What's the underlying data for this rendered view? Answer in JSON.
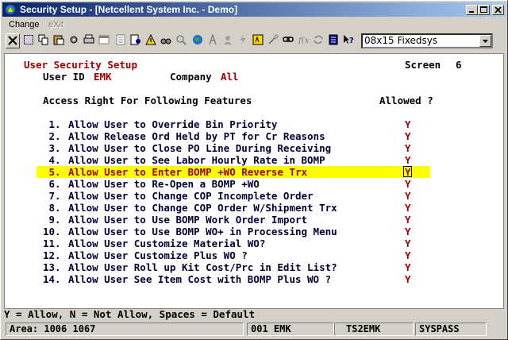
{
  "window": {
    "title": "Security Setup - [Netcellent System Inc. - Demo]"
  },
  "menu": {
    "change": "Change",
    "exit": "eXit"
  },
  "toolbar": {
    "font_select": "08x15 Fixedsys"
  },
  "screen": {
    "heading": "User Security Setup",
    "screen_label": "Screen",
    "screen_number": "6",
    "user_id_label": "User ID",
    "user_id": "EMK",
    "company_label": "Company",
    "company": "All",
    "section_title": "Access Right For Following Features",
    "allowed_header": "Allowed ?",
    "rows": [
      {
        "num": " 1.",
        "text": "Allow User to Override Bin Priority",
        "value": "Y"
      },
      {
        "num": " 2.",
        "text": "Allow Release Ord Held by PT for Cr Reasons",
        "value": "Y"
      },
      {
        "num": " 3.",
        "text": "Allow User to Close PO Line During Receiving",
        "value": "Y"
      },
      {
        "num": " 4.",
        "text": "Allow User to See Labor Hourly Rate in BOMP",
        "value": "Y"
      },
      {
        "num": " 5.",
        "text": "Allow User to Enter BOMP +WO Reverse Trx",
        "value": "Y"
      },
      {
        "num": " 6.",
        "text": "Allow User to Re-Open a BOMP +WO",
        "value": "Y"
      },
      {
        "num": " 7.",
        "text": "Allow User to Change COP Incomplete Order",
        "value": "Y"
      },
      {
        "num": " 8.",
        "text": "Allow User to Change COP Order W/Shipment Trx",
        "value": "Y"
      },
      {
        "num": " 9.",
        "text": "Allow User to Use BOMP Work Order Import",
        "value": "Y"
      },
      {
        "num": "10.",
        "text": "Allow User to Use BOMP WO+ in Processing Menu",
        "value": "Y"
      },
      {
        "num": "11.",
        "text": "Allow User Customize Material WO?",
        "value": "Y"
      },
      {
        "num": "12.",
        "text": "Allow User Customize Plus WO ?",
        "value": "Y"
      },
      {
        "num": "13.",
        "text": "Allow User Roll up Kit Cost/Prc in Edit List?",
        "value": "Y"
      },
      {
        "num": "14.",
        "text": "Allow User See Item Cost with BOMP Plus WO ?",
        "value": "Y"
      }
    ]
  },
  "help_line": "Y = Allow, N = Not Allow, Spaces = Default",
  "status": {
    "area": "Area: 1006 1067",
    "company_user": "001 EMK",
    "terminal": "TS2EMK",
    "password": "SYSPASS"
  },
  "colors": {
    "title_start": "#0a246a",
    "title_end": "#a6caf0",
    "field_red": "#a00000",
    "highlight": "#ffff00"
  }
}
